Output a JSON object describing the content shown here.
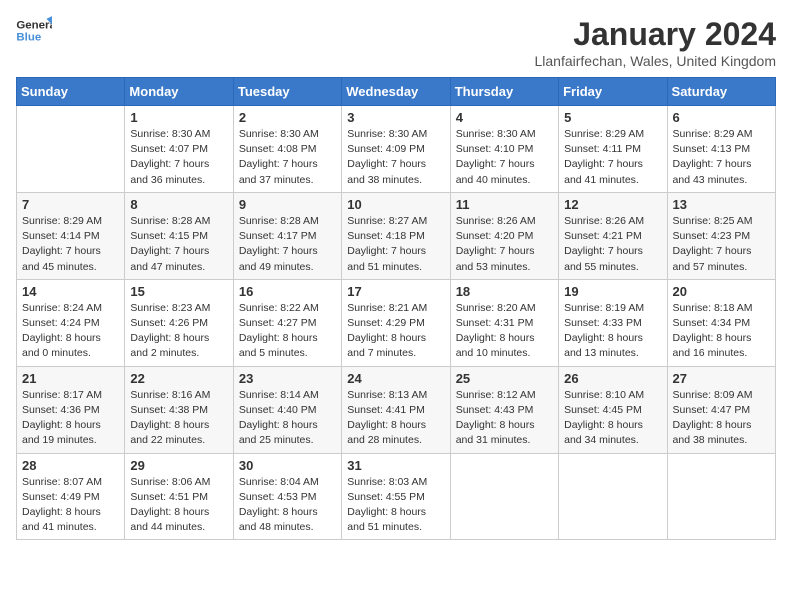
{
  "header": {
    "logo_line1": "General",
    "logo_line2": "Blue",
    "month": "January 2024",
    "location": "Llanfairfechan, Wales, United Kingdom"
  },
  "days_of_week": [
    "Sunday",
    "Monday",
    "Tuesday",
    "Wednesday",
    "Thursday",
    "Friday",
    "Saturday"
  ],
  "weeks": [
    [
      {
        "day": "",
        "sunrise": "",
        "sunset": "",
        "daylight": ""
      },
      {
        "day": "1",
        "sunrise": "Sunrise: 8:30 AM",
        "sunset": "Sunset: 4:07 PM",
        "daylight": "Daylight: 7 hours and 36 minutes."
      },
      {
        "day": "2",
        "sunrise": "Sunrise: 8:30 AM",
        "sunset": "Sunset: 4:08 PM",
        "daylight": "Daylight: 7 hours and 37 minutes."
      },
      {
        "day": "3",
        "sunrise": "Sunrise: 8:30 AM",
        "sunset": "Sunset: 4:09 PM",
        "daylight": "Daylight: 7 hours and 38 minutes."
      },
      {
        "day": "4",
        "sunrise": "Sunrise: 8:30 AM",
        "sunset": "Sunset: 4:10 PM",
        "daylight": "Daylight: 7 hours and 40 minutes."
      },
      {
        "day": "5",
        "sunrise": "Sunrise: 8:29 AM",
        "sunset": "Sunset: 4:11 PM",
        "daylight": "Daylight: 7 hours and 41 minutes."
      },
      {
        "day": "6",
        "sunrise": "Sunrise: 8:29 AM",
        "sunset": "Sunset: 4:13 PM",
        "daylight": "Daylight: 7 hours and 43 minutes."
      }
    ],
    [
      {
        "day": "7",
        "sunrise": "Sunrise: 8:29 AM",
        "sunset": "Sunset: 4:14 PM",
        "daylight": "Daylight: 7 hours and 45 minutes."
      },
      {
        "day": "8",
        "sunrise": "Sunrise: 8:28 AM",
        "sunset": "Sunset: 4:15 PM",
        "daylight": "Daylight: 7 hours and 47 minutes."
      },
      {
        "day": "9",
        "sunrise": "Sunrise: 8:28 AM",
        "sunset": "Sunset: 4:17 PM",
        "daylight": "Daylight: 7 hours and 49 minutes."
      },
      {
        "day": "10",
        "sunrise": "Sunrise: 8:27 AM",
        "sunset": "Sunset: 4:18 PM",
        "daylight": "Daylight: 7 hours and 51 minutes."
      },
      {
        "day": "11",
        "sunrise": "Sunrise: 8:26 AM",
        "sunset": "Sunset: 4:20 PM",
        "daylight": "Daylight: 7 hours and 53 minutes."
      },
      {
        "day": "12",
        "sunrise": "Sunrise: 8:26 AM",
        "sunset": "Sunset: 4:21 PM",
        "daylight": "Daylight: 7 hours and 55 minutes."
      },
      {
        "day": "13",
        "sunrise": "Sunrise: 8:25 AM",
        "sunset": "Sunset: 4:23 PM",
        "daylight": "Daylight: 7 hours and 57 minutes."
      }
    ],
    [
      {
        "day": "14",
        "sunrise": "Sunrise: 8:24 AM",
        "sunset": "Sunset: 4:24 PM",
        "daylight": "Daylight: 8 hours and 0 minutes."
      },
      {
        "day": "15",
        "sunrise": "Sunrise: 8:23 AM",
        "sunset": "Sunset: 4:26 PM",
        "daylight": "Daylight: 8 hours and 2 minutes."
      },
      {
        "day": "16",
        "sunrise": "Sunrise: 8:22 AM",
        "sunset": "Sunset: 4:27 PM",
        "daylight": "Daylight: 8 hours and 5 minutes."
      },
      {
        "day": "17",
        "sunrise": "Sunrise: 8:21 AM",
        "sunset": "Sunset: 4:29 PM",
        "daylight": "Daylight: 8 hours and 7 minutes."
      },
      {
        "day": "18",
        "sunrise": "Sunrise: 8:20 AM",
        "sunset": "Sunset: 4:31 PM",
        "daylight": "Daylight: 8 hours and 10 minutes."
      },
      {
        "day": "19",
        "sunrise": "Sunrise: 8:19 AM",
        "sunset": "Sunset: 4:33 PM",
        "daylight": "Daylight: 8 hours and 13 minutes."
      },
      {
        "day": "20",
        "sunrise": "Sunrise: 8:18 AM",
        "sunset": "Sunset: 4:34 PM",
        "daylight": "Daylight: 8 hours and 16 minutes."
      }
    ],
    [
      {
        "day": "21",
        "sunrise": "Sunrise: 8:17 AM",
        "sunset": "Sunset: 4:36 PM",
        "daylight": "Daylight: 8 hours and 19 minutes."
      },
      {
        "day": "22",
        "sunrise": "Sunrise: 8:16 AM",
        "sunset": "Sunset: 4:38 PM",
        "daylight": "Daylight: 8 hours and 22 minutes."
      },
      {
        "day": "23",
        "sunrise": "Sunrise: 8:14 AM",
        "sunset": "Sunset: 4:40 PM",
        "daylight": "Daylight: 8 hours and 25 minutes."
      },
      {
        "day": "24",
        "sunrise": "Sunrise: 8:13 AM",
        "sunset": "Sunset: 4:41 PM",
        "daylight": "Daylight: 8 hours and 28 minutes."
      },
      {
        "day": "25",
        "sunrise": "Sunrise: 8:12 AM",
        "sunset": "Sunset: 4:43 PM",
        "daylight": "Daylight: 8 hours and 31 minutes."
      },
      {
        "day": "26",
        "sunrise": "Sunrise: 8:10 AM",
        "sunset": "Sunset: 4:45 PM",
        "daylight": "Daylight: 8 hours and 34 minutes."
      },
      {
        "day": "27",
        "sunrise": "Sunrise: 8:09 AM",
        "sunset": "Sunset: 4:47 PM",
        "daylight": "Daylight: 8 hours and 38 minutes."
      }
    ],
    [
      {
        "day": "28",
        "sunrise": "Sunrise: 8:07 AM",
        "sunset": "Sunset: 4:49 PM",
        "daylight": "Daylight: 8 hours and 41 minutes."
      },
      {
        "day": "29",
        "sunrise": "Sunrise: 8:06 AM",
        "sunset": "Sunset: 4:51 PM",
        "daylight": "Daylight: 8 hours and 44 minutes."
      },
      {
        "day": "30",
        "sunrise": "Sunrise: 8:04 AM",
        "sunset": "Sunset: 4:53 PM",
        "daylight": "Daylight: 8 hours and 48 minutes."
      },
      {
        "day": "31",
        "sunrise": "Sunrise: 8:03 AM",
        "sunset": "Sunset: 4:55 PM",
        "daylight": "Daylight: 8 hours and 51 minutes."
      },
      {
        "day": "",
        "sunrise": "",
        "sunset": "",
        "daylight": ""
      },
      {
        "day": "",
        "sunrise": "",
        "sunset": "",
        "daylight": ""
      },
      {
        "day": "",
        "sunrise": "",
        "sunset": "",
        "daylight": ""
      }
    ]
  ]
}
